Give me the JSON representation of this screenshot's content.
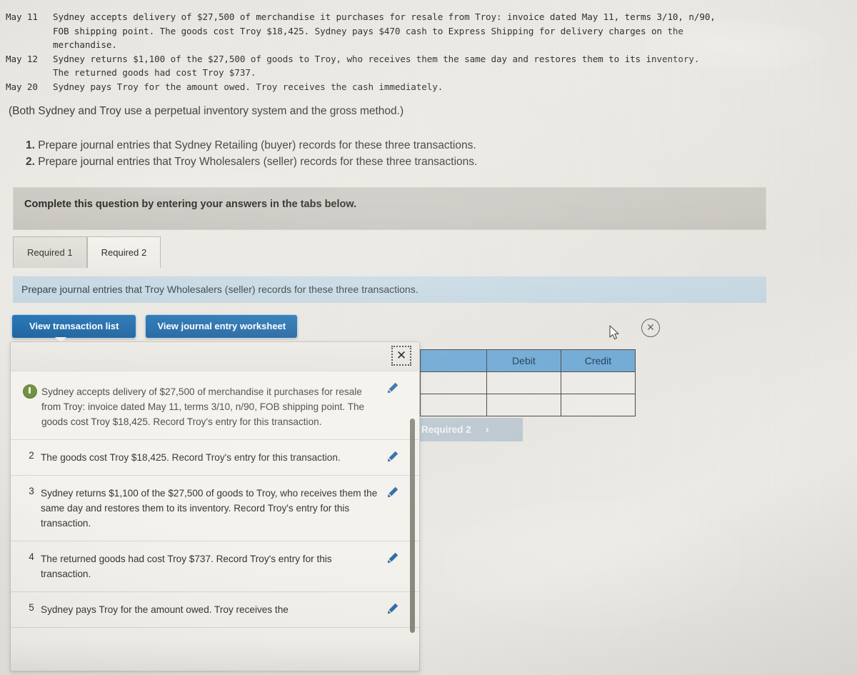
{
  "narrative": [
    {
      "date": "May 11",
      "lines": [
        "Sydney accepts delivery of $27,500 of merchandise it purchases for resale from Troy: invoice dated May 11, terms 3/10, n/90,",
        "FOB shipping point. The goods cost Troy $18,425. Sydney pays $470 cash to Express Shipping for delivery charges on the",
        "merchandise."
      ]
    },
    {
      "date": "May 12",
      "lines": [
        "Sydney returns $1,100 of the $27,500 of goods to Troy, who receives them the same day and restores them to its inventory.",
        "The returned goods had cost Troy $737."
      ]
    },
    {
      "date": "May 20",
      "lines": [
        "Sydney pays Troy for the amount owed. Troy receives the cash immediately."
      ]
    }
  ],
  "parenthetical": "(Both Sydney and Troy use a perpetual inventory system and the gross method.)",
  "requirements": [
    {
      "num": "1.",
      "text": "Prepare journal entries that Sydney Retailing (buyer) records for these three transactions."
    },
    {
      "num": "2.",
      "text": "Prepare journal entries that Troy Wholesalers (seller) records for these three transactions."
    }
  ],
  "banner": {
    "text": "Complete this question by entering your answers in the tabs below."
  },
  "tabs": [
    {
      "label": "Required 1",
      "active": false
    },
    {
      "label": "Required 2",
      "active": true
    }
  ],
  "instruction_bar": {
    "text": "Prepare journal entries that Troy Wholesalers (seller) records for these three transactions."
  },
  "buttons": {
    "view_transaction_list": "View transaction list",
    "view_journal_entry_worksheet": "View journal entry worksheet"
  },
  "transaction_list": {
    "close_icon": "close-x-icon",
    "items": [
      {
        "num": "1",
        "badge": "green-status-badge",
        "text": "Sydney accepts delivery of $27,500 of merchandise it purchases for resale from Troy: invoice dated May 11, terms 3/10, n/90, FOB shipping point. The goods cost Troy $18,425. Record Troy's entry for this transaction."
      },
      {
        "num": "2",
        "badge": "",
        "text": "The goods cost Troy $18,425. Record Troy's entry for this transaction."
      },
      {
        "num": "3",
        "badge": "",
        "text": "Sydney returns $1,100 of the $27,500 of goods to Troy, who receives them the same day and restores them to its inventory. Record Troy's entry for this transaction."
      },
      {
        "num": "4",
        "badge": "",
        "text": "The returned goods had cost Troy $737. Record Troy's entry for this transaction."
      },
      {
        "num": "5",
        "badge": "",
        "text": "Sydney pays Troy for the amount owed. Troy receives the"
      }
    ]
  },
  "journal_table": {
    "headers": [
      "",
      "Debit",
      "Credit"
    ],
    "rows": [
      [
        "",
        "",
        ""
      ],
      [
        "",
        "",
        ""
      ]
    ]
  },
  "req_nav": {
    "label": "Required 2",
    "chevron": "›"
  },
  "overlay_icons": {
    "cursor": "mouse-pointer-icon",
    "circle_close": "circle-x-icon"
  },
  "colors": {
    "accent_blue": "#1e6aa9",
    "table_header_blue": "#6aa6d3",
    "instruction_bar_blue": "#c2d5e0",
    "banner_gray": "#c9c7c0",
    "badge_green": "#6f8f3f",
    "pencil_blue": "#2f6ea8"
  }
}
